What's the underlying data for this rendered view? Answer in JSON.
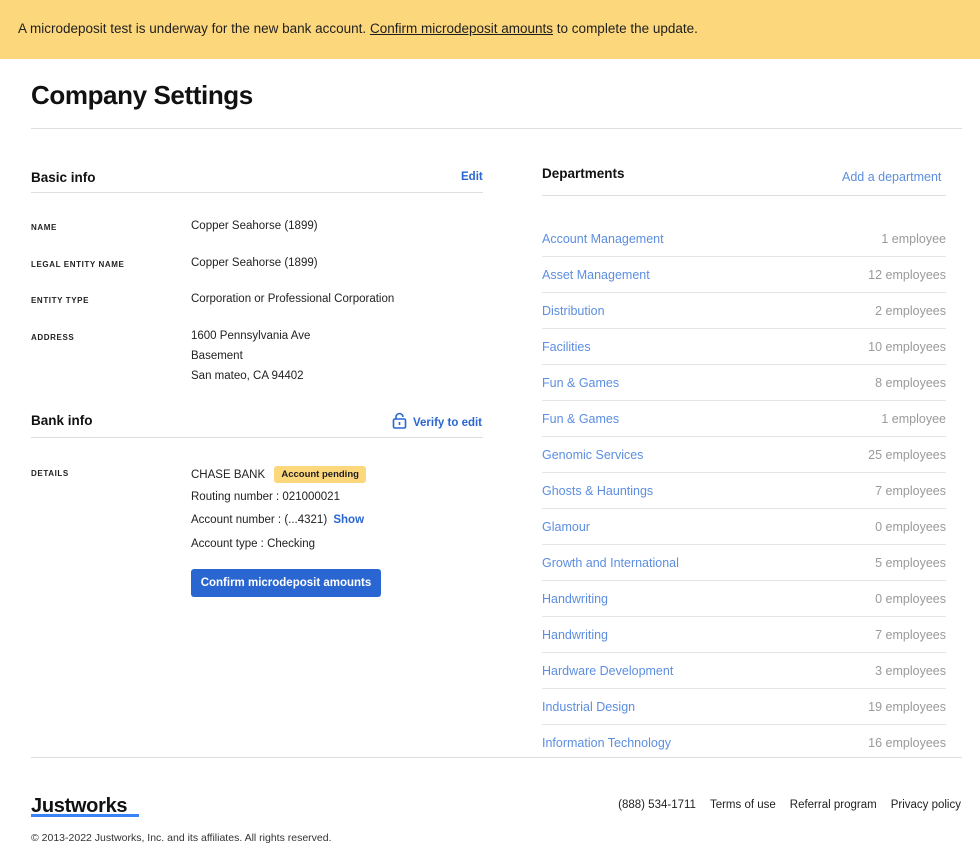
{
  "banner": {
    "prefix": "A microdeposit test is underway for the new bank account.",
    "link": "Confirm microdeposit amounts",
    "suffix": "to complete the update."
  },
  "page_title": "Company Settings",
  "basic_info": {
    "title": "Basic info",
    "edit": "Edit",
    "fields": {
      "name_label": "NAME",
      "name_value": "Copper Seahorse (1899)",
      "legal_label": "LEGAL ENTITY NAME",
      "legal_value": "Copper Seahorse (1899)",
      "entity_label": "ENTITY TYPE",
      "entity_value": "Corporation or Professional Corporation",
      "address_label": "ADDRESS",
      "address_line1": "1600 Pennsylvania Ave",
      "address_line2": "Basement",
      "address_line3": "San mateo, CA 94402"
    }
  },
  "bank_info": {
    "title": "Bank info",
    "verify": "Verify to edit",
    "details_label": "DETAILS",
    "bank_name": "CHASE BANK",
    "badge": "Account pending",
    "routing": "Routing number : 021000021",
    "account": "Account number : (...4321)",
    "show": "Show",
    "account_type": "Account type : Checking",
    "confirm_button": "Confirm microdeposit amounts"
  },
  "departments": {
    "title": "Departments",
    "add": "Add a department",
    "items": [
      {
        "name": "Account Management",
        "count": "1 employee"
      },
      {
        "name": "Asset Management",
        "count": "12 employees"
      },
      {
        "name": "Distribution",
        "count": "2 employees"
      },
      {
        "name": "Facilities",
        "count": "10 employees"
      },
      {
        "name": "Fun & Games",
        "count": "8 employees"
      },
      {
        "name": "Fun & Games",
        "count": "1 employee"
      },
      {
        "name": "Genomic Services",
        "count": "25 employees"
      },
      {
        "name": "Ghosts & Hauntings",
        "count": "7 employees"
      },
      {
        "name": "Glamour",
        "count": "0 employees"
      },
      {
        "name": "Growth and International",
        "count": "5 employees"
      },
      {
        "name": "Handwriting",
        "count": "0 employees"
      },
      {
        "name": "Handwriting",
        "count": "7 employees"
      },
      {
        "name": "Hardware Development",
        "count": "3 employees"
      },
      {
        "name": "Industrial Design",
        "count": "19 employees"
      },
      {
        "name": "Information Technology",
        "count": "16 employees"
      }
    ]
  },
  "footer": {
    "logo": "Justworks",
    "phone": "(888) 534-1711",
    "terms": "Terms of use",
    "referral": "Referral program",
    "privacy": "Privacy policy",
    "copyright": "© 2013-2022 Justworks, Inc. and its affiliates. All rights reserved."
  },
  "colors": {
    "banner": "#fcd77c",
    "accent": "#2a66d1",
    "dept_link": "#5c8ee0",
    "logo_underline": "#3b82f6"
  }
}
